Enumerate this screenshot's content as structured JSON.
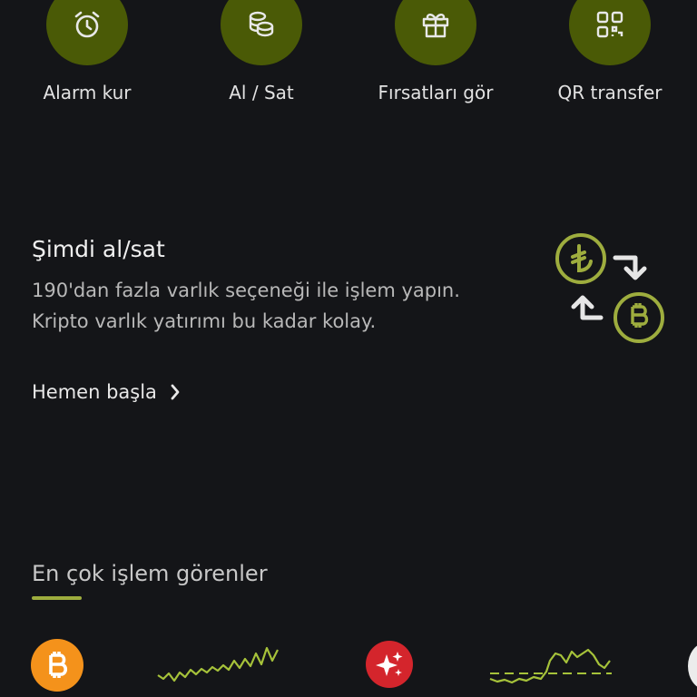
{
  "quick_actions": [
    {
      "label": "Alarm kur",
      "icon": "alarm-clock-icon"
    },
    {
      "label": "Al / Sat",
      "icon": "coins-icon"
    },
    {
      "label": "Fırsatları gör",
      "icon": "gift-icon"
    },
    {
      "label": "QR transfer",
      "icon": "qr-code-icon"
    }
  ],
  "promo": {
    "title": "Şimdi al/sat",
    "description_line1": "190'dan fazla varlık seçeneği ile işlem yapın.",
    "description_line2": "Kripto varlık yatırımı bu kadar kolay.",
    "cta": "Hemen başla"
  },
  "most_traded": {
    "title": "En çok işlem görenler",
    "items": [
      {
        "icon": "bitcoin-icon",
        "color": "#f4921b",
        "trend": "up"
      },
      {
        "icon": "sparkle-icon",
        "color": "#d4252c",
        "trend": "up"
      }
    ]
  },
  "colors": {
    "background": "#141518",
    "accent_circle": "#4a5a06",
    "accent_green": "#9ead3e",
    "chart_line": "#a6c23a"
  }
}
